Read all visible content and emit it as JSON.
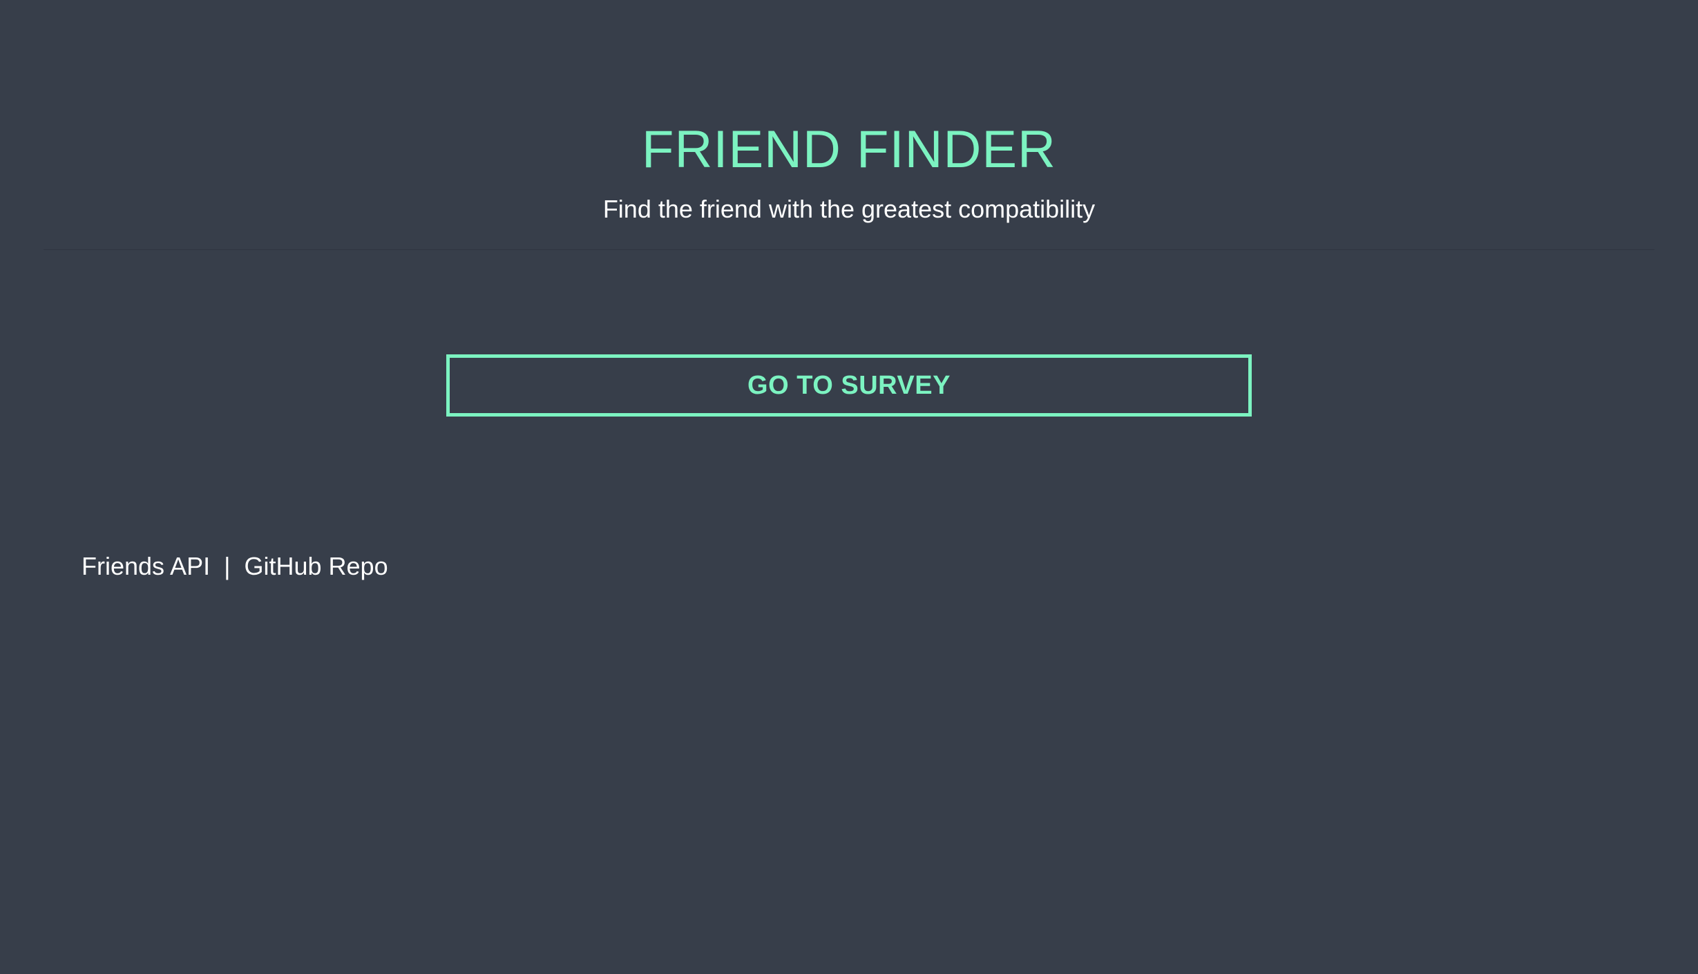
{
  "header": {
    "title": "FRIEND FINDER",
    "subtitle": "Find the friend with the greatest compatibility"
  },
  "main": {
    "survey_button_label": "GO TO SURVEY"
  },
  "footer": {
    "api_link": "Friends API",
    "separator": "|",
    "repo_link": "GitHub Repo"
  },
  "colors": {
    "background": "#373e4a",
    "accent": "#7cf3c1",
    "text": "#ffffff"
  }
}
